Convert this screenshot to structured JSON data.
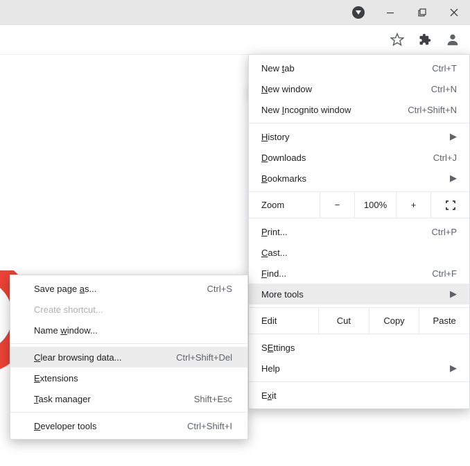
{
  "titlebar": {
    "dropdown": "app-menu",
    "minimize": "−",
    "maximize": "max",
    "close": "×"
  },
  "toolbar": {
    "star": "bookmark-star",
    "extensions": "extensions",
    "profile": "profile",
    "menu": "kebab-menu"
  },
  "menu": {
    "new_tab": "New tab",
    "new_tab_key": "Ctrl+T",
    "new_window": "New window",
    "new_window_key": "Ctrl+N",
    "new_incognito": "New Incognito window",
    "new_incognito_key": "Ctrl+Shift+N",
    "history": "History",
    "downloads": "Downloads",
    "downloads_key": "Ctrl+J",
    "bookmarks": "Bookmarks",
    "zoom": "Zoom",
    "zoom_value": "100%",
    "print": "Print...",
    "print_key": "Ctrl+P",
    "cast": "Cast...",
    "find": "Find...",
    "find_key": "Ctrl+F",
    "more_tools": "More tools",
    "edit": "Edit",
    "cut": "Cut",
    "copy": "Copy",
    "paste": "Paste",
    "settings": "Settings",
    "help": "Help",
    "exit": "Exit"
  },
  "submenu": {
    "save_page_as": "Save page as...",
    "save_page_as_key": "Ctrl+S",
    "create_shortcut": "Create shortcut...",
    "name_window": "Name window...",
    "clear_browsing_data": "Clear browsing data...",
    "clear_browsing_data_key": "Ctrl+Shift+Del",
    "extensions": "Extensions",
    "task_manager": "Task manager",
    "task_manager_key": "Shift+Esc",
    "developer_tools": "Developer tools",
    "developer_tools_key": "Ctrl+Shift+I"
  },
  "underline": {
    "t": "t",
    "N": "N",
    "I": "I",
    "H": "H",
    "D": "D",
    "B": "B",
    "P": "P",
    "C": "C",
    "F": "F",
    "S": "S",
    "E": "E",
    "a": "a",
    "w": "w",
    "T_cap": "T",
    "x": "x"
  }
}
